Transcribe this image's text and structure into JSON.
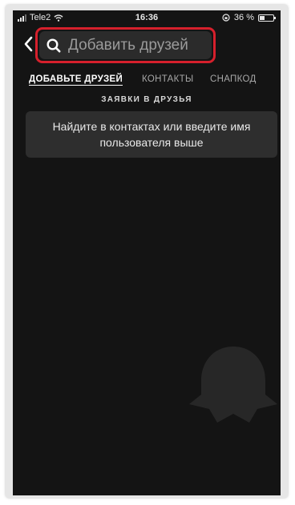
{
  "status_bar": {
    "carrier": "Tele2",
    "time": "16:36",
    "battery_percent_label": "36 %",
    "battery_level": 0.36,
    "icons": [
      "signal-icon",
      "wifi-icon",
      "rotation-lock-icon",
      "battery-icon"
    ]
  },
  "header": {
    "back_icon": "chevron-left-icon",
    "search": {
      "icon": "search-icon",
      "placeholder": "Добавить друзей",
      "value": "",
      "highlight_color": "#d6202c"
    }
  },
  "tabs": [
    {
      "label": "ДОБАВЬТЕ ДРУЗЕЙ",
      "active": true
    },
    {
      "label": "КОНТАКТЫ",
      "active": false
    },
    {
      "label": "СНАПКОД",
      "active": false
    }
  ],
  "section": {
    "title": "ЗАЯВКИ В ДРУЗЬЯ"
  },
  "empty_state": {
    "message": "Найдите в контактах или введите имя пользователя выше"
  },
  "colors": {
    "background": "#141414",
    "card": "#2e2e2e",
    "accent_highlight": "#d6202c",
    "text_primary": "#ffffff",
    "text_secondary": "#a7a7a7"
  }
}
